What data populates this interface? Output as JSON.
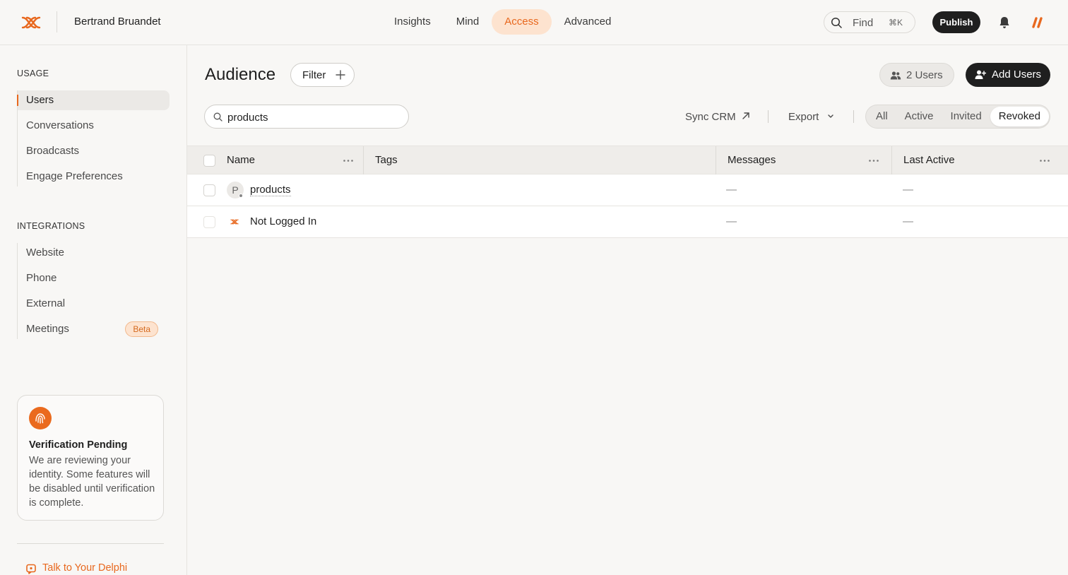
{
  "topbar": {
    "workspace_name": "Bertrand Bruandet",
    "nav": [
      "Insights",
      "Mind",
      "Access",
      "Advanced"
    ],
    "active_nav": "Access",
    "find_label": "Find",
    "find_shortcut": "⌘K",
    "publish_label": "Publish"
  },
  "sidebar": {
    "usage_title": "USAGE",
    "usage_items": [
      "Users",
      "Conversations",
      "Broadcasts",
      "Engage Preferences"
    ],
    "integrations_title": "INTEGRATIONS",
    "integration_items": [
      "Website",
      "Phone",
      "External",
      "Meetings"
    ],
    "beta_label": "Beta",
    "verification": {
      "title": "Verification Pending",
      "text": "We are reviewing your identity. Some features will be disabled until verification is complete."
    },
    "talk_label": "Talk to Your Delphi"
  },
  "main": {
    "title": "Audience",
    "filter_label": "Filter",
    "users_count_label": "2 Users",
    "add_users_label": "Add Users",
    "search_value": "products",
    "sync_crm_label": "Sync CRM",
    "export_label": "Export",
    "segments": [
      "All",
      "Active",
      "Invited",
      "Revoked"
    ],
    "active_segment": "Revoked"
  },
  "table": {
    "columns": [
      "Name",
      "Tags",
      "Messages",
      "Last Active"
    ],
    "rows": [
      {
        "initial": "P",
        "name": "products",
        "messages": "—",
        "last_active": "—"
      },
      {
        "initial": "",
        "name": "Not Logged In",
        "messages": "—",
        "last_active": "—"
      }
    ]
  },
  "colors": {
    "accent": "#e8681e",
    "accent_soft": "#fde3cf",
    "dark": "#1f1f1f",
    "background": "#f8f7f5"
  }
}
